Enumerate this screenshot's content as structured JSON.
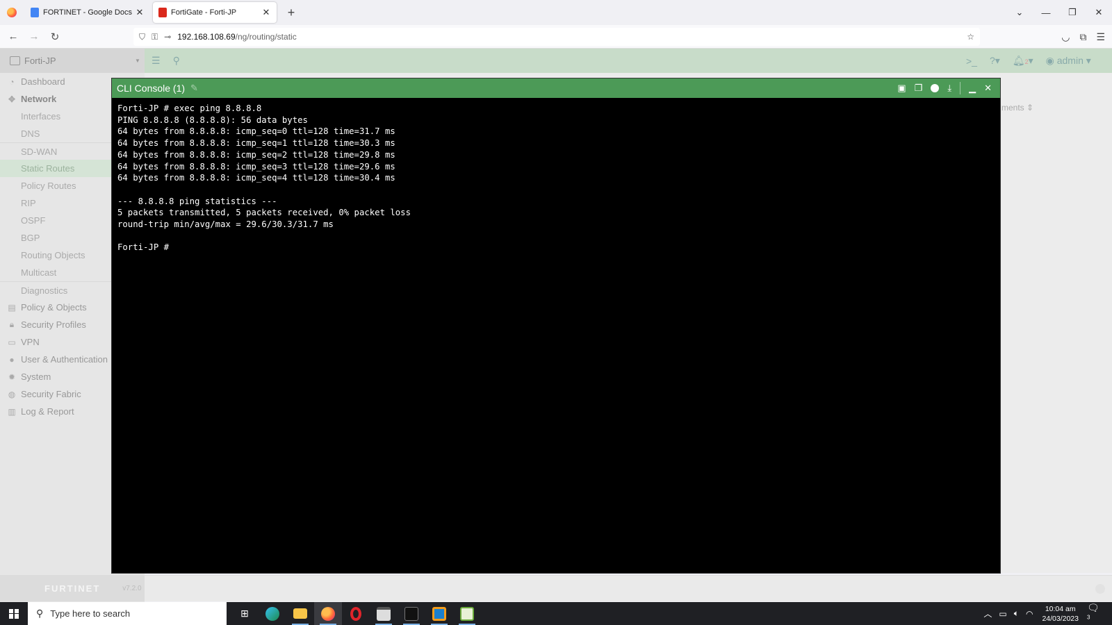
{
  "browser": {
    "tabs": [
      {
        "title": "FORTINET - Google Docs",
        "active": false
      },
      {
        "title": "FortiGate - Forti-JP",
        "active": true
      }
    ],
    "url_host": "192.168.108.69",
    "url_path": "/ng/routing/static"
  },
  "fortigate": {
    "device_name": "Forti-JP",
    "admin_user": "admin",
    "alert_count": "2",
    "version": "v7.2.0",
    "brand": "FURTINET",
    "column_partial": "ments",
    "sidebar": [
      {
        "label": "Dashboard",
        "icon": "dashboard-icon",
        "type": "top"
      },
      {
        "label": "Network",
        "icon": "network-icon",
        "type": "top-bold"
      },
      {
        "label": "Interfaces",
        "type": "sub"
      },
      {
        "label": "DNS",
        "type": "sub"
      },
      {
        "label": "SD-WAN",
        "type": "sub-div"
      },
      {
        "label": "Static Routes",
        "type": "sub-sel"
      },
      {
        "label": "Policy Routes",
        "type": "sub"
      },
      {
        "label": "RIP",
        "type": "sub"
      },
      {
        "label": "OSPF",
        "type": "sub"
      },
      {
        "label": "BGP",
        "type": "sub"
      },
      {
        "label": "Routing Objects",
        "type": "sub"
      },
      {
        "label": "Multicast",
        "type": "sub"
      },
      {
        "label": "Diagnostics",
        "type": "sub-div"
      },
      {
        "label": "Policy & Objects",
        "icon": "policy-icon",
        "type": "top"
      },
      {
        "label": "Security Profiles",
        "icon": "lock-icon",
        "type": "top"
      },
      {
        "label": "VPN",
        "icon": "monitor-icon",
        "type": "top"
      },
      {
        "label": "User & Authentication",
        "icon": "user-icon",
        "type": "top"
      },
      {
        "label": "System",
        "icon": "gear-icon",
        "type": "top"
      },
      {
        "label": "Security Fabric",
        "icon": "fabric-icon",
        "type": "top"
      },
      {
        "label": "Log & Report",
        "icon": "chart-icon",
        "type": "top"
      }
    ]
  },
  "cli": {
    "title": "CLI Console (1)",
    "output": "Forti-JP # exec ping 8.8.8.8\nPING 8.8.8.8 (8.8.8.8): 56 data bytes\n64 bytes from 8.8.8.8: icmp_seq=0 ttl=128 time=31.7 ms\n64 bytes from 8.8.8.8: icmp_seq=1 ttl=128 time=30.3 ms\n64 bytes from 8.8.8.8: icmp_seq=2 ttl=128 time=29.8 ms\n64 bytes from 8.8.8.8: icmp_seq=3 ttl=128 time=29.6 ms\n64 bytes from 8.8.8.8: icmp_seq=4 ttl=128 time=30.4 ms\n\n--- 8.8.8.8 ping statistics ---\n5 packets transmitted, 5 packets received, 0% packet loss\nround-trip min/avg/max = 29.6/30.3/31.7 ms\n\nForti-JP # "
  },
  "taskbar": {
    "search_placeholder": "Type here to search",
    "time": "10:04 am",
    "date": "24/03/2023",
    "notification_count": "3"
  },
  "colors": {
    "console_header": "#4c9a57",
    "app_header": "#c8dcc9",
    "fortinet_red": "#da291c"
  }
}
